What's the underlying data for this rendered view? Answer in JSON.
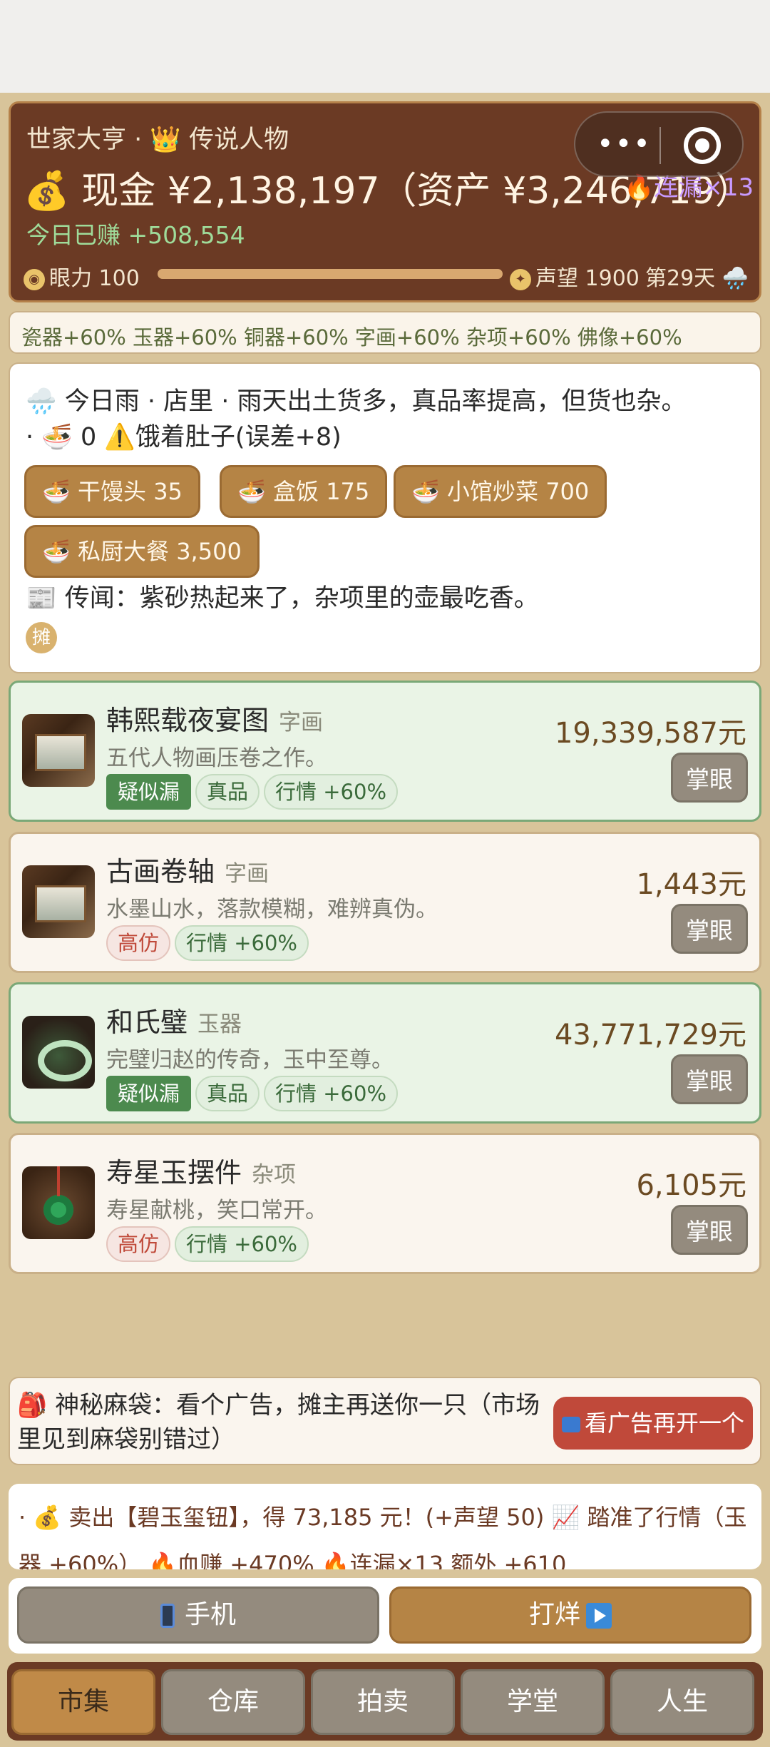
{
  "header": {
    "rank": "世家大亨 · 👑 传说人物",
    "cash": "💰 现金 ¥2,138,197（资产 ¥3,246,719）",
    "streak": "🔥连漏×13",
    "earned_today": "今日已赚 +508,554",
    "eye_label": "眼力",
    "eye_value": "100",
    "eye_progress": 1.0,
    "reputation_label": "声望",
    "reputation_value": "1900",
    "day": "第29天",
    "weather_icon": "cloud-rain-icon"
  },
  "bonus_strip": "瓷器+60% 玉器+60% 铜器+60% 字画+60% 杂项+60% 佛像+60%",
  "info": {
    "weather": "🌧️ 今日雨 · 店里 · 雨天出土货多，真品率提高，但货也杂。",
    "hunger": "· 🍜 0 ⚠️饿着肚子(误差+8)",
    "foods": [
      "🍜 干馒头 35",
      "🍜 盒饭 175",
      "🍜 小馆炒菜 700",
      "🍜 私厨大餐 3,500"
    ],
    "rumor": "📰 传闻：紫砂热起来了，杂项里的壶最吃香。",
    "stall_badge": "摊"
  },
  "items": [
    {
      "name": "韩熙载夜宴图",
      "category": "字画",
      "desc": "五代人物画压卷之作。",
      "price": "19,339,587元",
      "tags": [
        "疑似漏",
        "真品",
        "行情 +60%"
      ],
      "button": "掌眼"
    },
    {
      "name": "古画卷轴",
      "category": "字画",
      "desc": "水墨山水，落款模糊，难辨真伪。",
      "price": "1,443元",
      "tags": [
        "高仿",
        "行情 +60%"
      ],
      "button": "掌眼"
    },
    {
      "name": "和氏璧",
      "category": "玉器",
      "desc": "完璧归赵的传奇，玉中至尊。",
      "price": "43,771,729元",
      "tags": [
        "疑似漏",
        "真品",
        "行情 +60%"
      ],
      "button": "掌眼"
    },
    {
      "name": "寿星玉摆件",
      "category": "杂项",
      "desc": "寿星献桃，笑口常开。",
      "price": "6,105元",
      "tags": [
        "高仿",
        "行情 +60%"
      ],
      "button": "掌眼"
    }
  ],
  "bag": {
    "text": "🎒 神秘麻袋：看个广告，摊主再送你一只（市场里见到麻袋别错过）",
    "button": "看广告再开一个"
  },
  "log": "· 💰 卖出【碧玉玺钮】，得 73,185 元！(+声望 50) 📈 踏准了行情（玉器 +60%） 🔥血赚 +470% 🔥连漏×13 额外 +610",
  "actions": {
    "phone": "手机",
    "close_shop": "打烊"
  },
  "nav": [
    "市集",
    "仓库",
    "拍卖",
    "学堂",
    "人生"
  ]
}
